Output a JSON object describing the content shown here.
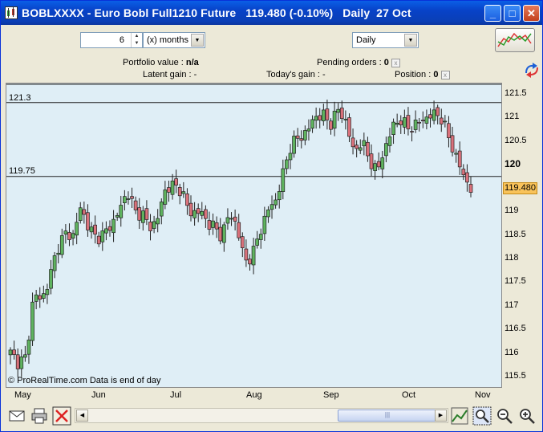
{
  "window": {
    "title": "BOBLXXXX - Euro Bobl Full1210 Future   119.480 (-0.10%)   Daily  27 Oct",
    "minimize": "_",
    "maximize": "□",
    "close": "✕"
  },
  "toolbar": {
    "period_value": "6",
    "period_unit": "(x) months",
    "interval": "Daily"
  },
  "info": {
    "portfolio_label": "Portfolio value : ",
    "portfolio_value": "n/a",
    "latent_gain": "Latent gain : -",
    "todays_gain": "Today's gain : -",
    "pending_label": "Pending orders : ",
    "pending_value": "0",
    "position_label": "Position : ",
    "position_value": "0"
  },
  "chart_data": {
    "type": "candlestick",
    "symbol": "BOBLXXXX",
    "last_price": "119.480",
    "ylim": [
      115.3,
      121.7
    ],
    "yticks": [
      "121.5",
      "121",
      "120.5",
      "120",
      "119.5",
      "119",
      "118.5",
      "118",
      "117.5",
      "117",
      "116.5",
      "116",
      "115.5"
    ],
    "xticks": [
      "May",
      "Jun",
      "Jul",
      "Aug",
      "Sep",
      "Oct",
      "Nov"
    ],
    "horizontal_lines": [
      {
        "label": "121.3",
        "value": 121.3
      },
      {
        "label": "119.75",
        "value": 119.75
      }
    ],
    "close_path": [
      116.05,
      115.85,
      115.95,
      117.3,
      117.15,
      117.6,
      118.25,
      118.55,
      118.5,
      119.1,
      118.7,
      118.45,
      118.55,
      118.75,
      119.05,
      119.45,
      119.0,
      118.95,
      118.65,
      118.95,
      119.55,
      119.55,
      119.45,
      118.95,
      119.05,
      118.85,
      118.7,
      118.5,
      118.95,
      118.75,
      117.95,
      118.1,
      118.6,
      119.05,
      119.25,
      119.85,
      120.45,
      120.55,
      120.7,
      121.0,
      121.05,
      120.85,
      121.15,
      120.9,
      120.25,
      120.5,
      120.1,
      119.85,
      120.35,
      120.8,
      120.95,
      120.75,
      120.85,
      120.95,
      121.05,
      121.05,
      120.65,
      120.2,
      119.8,
      119.48
    ],
    "copyright": "© ProRealTime.com",
    "data_note": "Data is end of day"
  }
}
